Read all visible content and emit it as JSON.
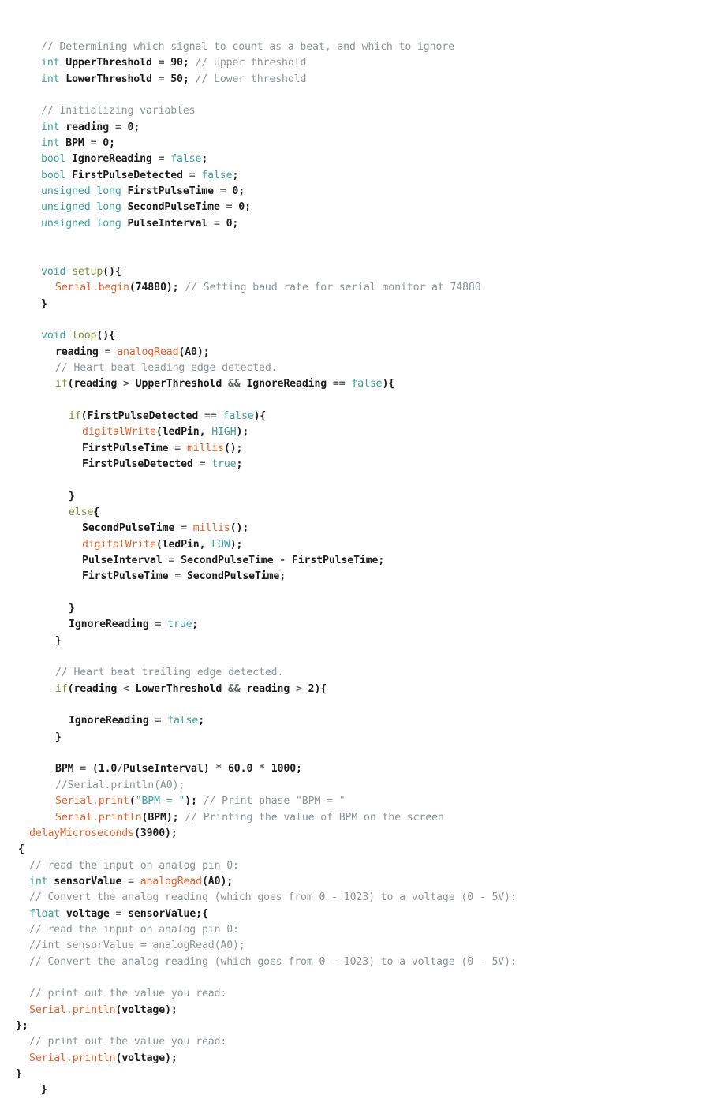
{
  "document": {
    "type": "source-code-listing",
    "language": "Arduino C++",
    "background_color": "#ffffff",
    "colors": {
      "keyword": "#3c9f9f",
      "constant": "#3c9f9f",
      "string": "#3c9f9f",
      "function": "#e8612a",
      "function_name": "#7f8f34",
      "control": "#7f8f34",
      "comment": "#8e9498",
      "plain": "#1c1c1c",
      "operator": "#5a5f63"
    }
  },
  "lines": [
    {
      "indent": 52,
      "tokens": [
        {
          "c": "comment",
          "t": "// Determining which signal to count as a beat, and which to ignore"
        }
      ]
    },
    {
      "indent": 52,
      "tokens": [
        {
          "c": "kw",
          "t": "int"
        },
        {
          "c": "plain",
          "t": " UpperThreshold "
        },
        {
          "c": "op",
          "t": "="
        },
        {
          "c": "num",
          "t": " 90"
        },
        {
          "c": "punc",
          "t": ";"
        },
        {
          "c": "comment",
          "t": " // Upper threshold"
        }
      ]
    },
    {
      "indent": 52,
      "tokens": [
        {
          "c": "kw",
          "t": "int"
        },
        {
          "c": "plain",
          "t": " LowerThreshold "
        },
        {
          "c": "op",
          "t": "="
        },
        {
          "c": "num",
          "t": " 50"
        },
        {
          "c": "punc",
          "t": ";"
        },
        {
          "c": "comment",
          "t": " // Lower threshold"
        }
      ]
    },
    {
      "indent": 52,
      "tokens": []
    },
    {
      "indent": 52,
      "tokens": [
        {
          "c": "comment",
          "t": "// Initializing variables"
        }
      ]
    },
    {
      "indent": 52,
      "tokens": [
        {
          "c": "kw",
          "t": "int"
        },
        {
          "c": "plain",
          "t": " reading "
        },
        {
          "c": "op",
          "t": "="
        },
        {
          "c": "num",
          "t": " 0"
        },
        {
          "c": "punc",
          "t": ";"
        }
      ]
    },
    {
      "indent": 52,
      "tokens": [
        {
          "c": "kw",
          "t": "int"
        },
        {
          "c": "plain",
          "t": " BPM "
        },
        {
          "c": "op",
          "t": "="
        },
        {
          "c": "num",
          "t": " 0"
        },
        {
          "c": "punc",
          "t": ";"
        }
      ]
    },
    {
      "indent": 52,
      "tokens": [
        {
          "c": "kw",
          "t": "bool"
        },
        {
          "c": "plain",
          "t": " IgnoreReading "
        },
        {
          "c": "op",
          "t": "="
        },
        {
          "c": "const",
          "t": " false"
        },
        {
          "c": "punc",
          "t": ";"
        }
      ]
    },
    {
      "indent": 52,
      "tokens": [
        {
          "c": "kw",
          "t": "bool"
        },
        {
          "c": "plain",
          "t": " FirstPulseDetected "
        },
        {
          "c": "op",
          "t": "="
        },
        {
          "c": "const",
          "t": " false"
        },
        {
          "c": "punc",
          "t": ";"
        }
      ]
    },
    {
      "indent": 52,
      "tokens": [
        {
          "c": "kw",
          "t": "unsigned long"
        },
        {
          "c": "plain",
          "t": " FirstPulseTime "
        },
        {
          "c": "op",
          "t": "="
        },
        {
          "c": "num",
          "t": " 0"
        },
        {
          "c": "punc",
          "t": ";"
        }
      ]
    },
    {
      "indent": 52,
      "tokens": [
        {
          "c": "kw",
          "t": "unsigned long"
        },
        {
          "c": "plain",
          "t": " SecondPulseTime "
        },
        {
          "c": "op",
          "t": "="
        },
        {
          "c": "num",
          "t": " 0"
        },
        {
          "c": "punc",
          "t": ";"
        }
      ]
    },
    {
      "indent": 52,
      "tokens": [
        {
          "c": "kw",
          "t": "unsigned long"
        },
        {
          "c": "plain",
          "t": " PulseInterval "
        },
        {
          "c": "op",
          "t": "="
        },
        {
          "c": "num",
          "t": " 0"
        },
        {
          "c": "punc",
          "t": ";"
        }
      ]
    },
    {
      "indent": 52,
      "tokens": []
    },
    {
      "indent": 52,
      "tokens": []
    },
    {
      "indent": 52,
      "tokens": [
        {
          "c": "kw",
          "t": "void"
        },
        {
          "c": "fname",
          "t": " setup"
        },
        {
          "c": "punc",
          "t": "(){"
        }
      ]
    },
    {
      "indent": 70,
      "tokens": [
        {
          "c": "func",
          "t": "Serial.begin"
        },
        {
          "c": "punc",
          "t": "("
        },
        {
          "c": "num",
          "t": "74880"
        },
        {
          "c": "punc",
          "t": ");"
        },
        {
          "c": "comment",
          "t": " // Setting baud rate for serial monitor at 74880"
        }
      ]
    },
    {
      "indent": 52,
      "tokens": [
        {
          "c": "punc",
          "t": "}"
        }
      ]
    },
    {
      "indent": 52,
      "tokens": []
    },
    {
      "indent": 52,
      "tokens": [
        {
          "c": "kw",
          "t": "void"
        },
        {
          "c": "fname",
          "t": " loop"
        },
        {
          "c": "punc",
          "t": "(){"
        }
      ]
    },
    {
      "indent": 70,
      "tokens": [
        {
          "c": "plain",
          "t": "reading "
        },
        {
          "c": "op",
          "t": "="
        },
        {
          "c": "func",
          "t": " analogRead"
        },
        {
          "c": "punc",
          "t": "("
        },
        {
          "c": "plain",
          "t": "A0"
        },
        {
          "c": "punc",
          "t": ");"
        }
      ]
    },
    {
      "indent": 70,
      "tokens": [
        {
          "c": "comment",
          "t": "// Heart beat leading edge detected."
        }
      ]
    },
    {
      "indent": 70,
      "tokens": [
        {
          "c": "ctrl",
          "t": "if"
        },
        {
          "c": "punc",
          "t": "("
        },
        {
          "c": "plain",
          "t": "reading "
        },
        {
          "c": "op",
          "t": ">"
        },
        {
          "c": "plain",
          "t": " UpperThreshold "
        },
        {
          "c": "op",
          "t": "&&"
        },
        {
          "c": "plain",
          "t": " IgnoreReading "
        },
        {
          "c": "op",
          "t": "=="
        },
        {
          "c": "const",
          "t": " false"
        },
        {
          "c": "punc",
          "t": "){"
        }
      ]
    },
    {
      "indent": 70,
      "tokens": []
    },
    {
      "indent": 87,
      "tokens": [
        {
          "c": "ctrl",
          "t": "if"
        },
        {
          "c": "punc",
          "t": "("
        },
        {
          "c": "plain",
          "t": "FirstPulseDetected "
        },
        {
          "c": "op",
          "t": "=="
        },
        {
          "c": "const",
          "t": " false"
        },
        {
          "c": "punc",
          "t": "){"
        }
      ]
    },
    {
      "indent": 104,
      "tokens": [
        {
          "c": "func",
          "t": "digitalWrite"
        },
        {
          "c": "punc",
          "t": "("
        },
        {
          "c": "plain",
          "t": "ledPin, "
        },
        {
          "c": "const",
          "t": "HIGH"
        },
        {
          "c": "punc",
          "t": ");"
        }
      ]
    },
    {
      "indent": 104,
      "tokens": [
        {
          "c": "plain",
          "t": "FirstPulseTime "
        },
        {
          "c": "op",
          "t": "="
        },
        {
          "c": "func",
          "t": " millis"
        },
        {
          "c": "punc",
          "t": "();"
        }
      ]
    },
    {
      "indent": 104,
      "tokens": [
        {
          "c": "plain",
          "t": "FirstPulseDetected "
        },
        {
          "c": "op",
          "t": "="
        },
        {
          "c": "const",
          "t": " true"
        },
        {
          "c": "punc",
          "t": ";"
        }
      ]
    },
    {
      "indent": 104,
      "tokens": []
    },
    {
      "indent": 87,
      "tokens": [
        {
          "c": "punc",
          "t": "}"
        }
      ]
    },
    {
      "indent": 87,
      "tokens": [
        {
          "c": "ctrl",
          "t": "else"
        },
        {
          "c": "punc",
          "t": "{"
        }
      ]
    },
    {
      "indent": 104,
      "tokens": [
        {
          "c": "plain",
          "t": "SecondPulseTime "
        },
        {
          "c": "op",
          "t": "="
        },
        {
          "c": "func",
          "t": " millis"
        },
        {
          "c": "punc",
          "t": "();"
        }
      ]
    },
    {
      "indent": 104,
      "tokens": [
        {
          "c": "func",
          "t": "digitalWrite"
        },
        {
          "c": "punc",
          "t": "("
        },
        {
          "c": "plain",
          "t": "ledPin, "
        },
        {
          "c": "const",
          "t": "LOW"
        },
        {
          "c": "punc",
          "t": ");"
        }
      ]
    },
    {
      "indent": 104,
      "tokens": [
        {
          "c": "plain",
          "t": "PulseInterval "
        },
        {
          "c": "op",
          "t": "="
        },
        {
          "c": "plain",
          "t": " SecondPulseTime "
        },
        {
          "c": "op",
          "t": "-"
        },
        {
          "c": "plain",
          "t": " FirstPulseTime"
        },
        {
          "c": "punc",
          "t": ";"
        }
      ]
    },
    {
      "indent": 104,
      "tokens": [
        {
          "c": "plain",
          "t": "FirstPulseTime "
        },
        {
          "c": "op",
          "t": "="
        },
        {
          "c": "plain",
          "t": " SecondPulseTime"
        },
        {
          "c": "punc",
          "t": ";"
        }
      ]
    },
    {
      "indent": 104,
      "tokens": []
    },
    {
      "indent": 87,
      "tokens": [
        {
          "c": "punc",
          "t": "}"
        }
      ]
    },
    {
      "indent": 87,
      "tokens": [
        {
          "c": "plain",
          "t": "IgnoreReading "
        },
        {
          "c": "op",
          "t": "="
        },
        {
          "c": "const",
          "t": " true"
        },
        {
          "c": "punc",
          "t": ";"
        }
      ]
    },
    {
      "indent": 70,
      "tokens": [
        {
          "c": "punc",
          "t": "}"
        }
      ]
    },
    {
      "indent": 70,
      "tokens": []
    },
    {
      "indent": 70,
      "tokens": [
        {
          "c": "comment",
          "t": "// Heart beat trailing edge detected."
        }
      ]
    },
    {
      "indent": 70,
      "tokens": [
        {
          "c": "ctrl",
          "t": "if"
        },
        {
          "c": "punc",
          "t": "("
        },
        {
          "c": "plain",
          "t": "reading "
        },
        {
          "c": "op",
          "t": "<"
        },
        {
          "c": "plain",
          "t": " LowerThreshold "
        },
        {
          "c": "op",
          "t": "&&"
        },
        {
          "c": "plain",
          "t": " reading "
        },
        {
          "c": "op",
          "t": ">"
        },
        {
          "c": "num",
          "t": " 2"
        },
        {
          "c": "punc",
          "t": "){"
        }
      ]
    },
    {
      "indent": 70,
      "tokens": []
    },
    {
      "indent": 87,
      "tokens": [
        {
          "c": "plain",
          "t": "IgnoreReading "
        },
        {
          "c": "op",
          "t": "="
        },
        {
          "c": "const",
          "t": " false"
        },
        {
          "c": "punc",
          "t": ";"
        }
      ]
    },
    {
      "indent": 70,
      "tokens": [
        {
          "c": "punc",
          "t": "}"
        }
      ]
    },
    {
      "indent": 70,
      "tokens": []
    },
    {
      "indent": 70,
      "tokens": [
        {
          "c": "plain",
          "t": "BPM "
        },
        {
          "c": "op",
          "t": "="
        },
        {
          "c": "punc",
          "t": " ("
        },
        {
          "c": "num",
          "t": "1.0"
        },
        {
          "c": "op",
          "t": "/"
        },
        {
          "c": "plain",
          "t": "PulseInterval"
        },
        {
          "c": "punc",
          "t": ") "
        },
        {
          "c": "op",
          "t": "*"
        },
        {
          "c": "num",
          "t": " 60.0 "
        },
        {
          "c": "op",
          "t": "*"
        },
        {
          "c": "num",
          "t": " 1000"
        },
        {
          "c": "punc",
          "t": ";"
        }
      ]
    },
    {
      "indent": 70,
      "tokens": [
        {
          "c": "comment",
          "t": "//Serial.println(A0);"
        }
      ]
    },
    {
      "indent": 70,
      "tokens": [
        {
          "c": "func",
          "t": "Serial.print"
        },
        {
          "c": "punc",
          "t": "("
        },
        {
          "c": "str",
          "t": "\"BPM = \""
        },
        {
          "c": "punc",
          "t": ");"
        },
        {
          "c": "comment",
          "t": " // Print phase \"BPM = \""
        }
      ]
    },
    {
      "indent": 70,
      "tokens": [
        {
          "c": "func",
          "t": "Serial.println"
        },
        {
          "c": "punc",
          "t": "("
        },
        {
          "c": "plain",
          "t": "BPM"
        },
        {
          "c": "punc",
          "t": ");"
        },
        {
          "c": "comment",
          "t": " // Printing the value of BPM on the screen"
        }
      ]
    },
    {
      "indent": 37,
      "tokens": [
        {
          "c": "func",
          "t": "delayMicroseconds"
        },
        {
          "c": "punc",
          "t": "("
        },
        {
          "c": "num",
          "t": "3900"
        },
        {
          "c": "punc",
          "t": ");"
        }
      ]
    },
    {
      "indent": 23,
      "tokens": [
        {
          "c": "punc",
          "t": "{"
        }
      ]
    },
    {
      "indent": 37,
      "tokens": [
        {
          "c": "comment",
          "t": "// read the input on analog pin 0:"
        }
      ]
    },
    {
      "indent": 37,
      "tokens": [
        {
          "c": "kw",
          "t": "int"
        },
        {
          "c": "plain",
          "t": " sensorValue "
        },
        {
          "c": "op",
          "t": "="
        },
        {
          "c": "func",
          "t": " analogRead"
        },
        {
          "c": "punc",
          "t": "("
        },
        {
          "c": "plain",
          "t": "A0"
        },
        {
          "c": "punc",
          "t": ");"
        }
      ]
    },
    {
      "indent": 37,
      "tokens": [
        {
          "c": "comment",
          "t": "// Convert the analog reading (which goes from 0 - 1023) to a voltage (0 - 5V):"
        }
      ]
    },
    {
      "indent": 37,
      "tokens": [
        {
          "c": "kw",
          "t": "float"
        },
        {
          "c": "plain",
          "t": " voltage "
        },
        {
          "c": "op",
          "t": "="
        },
        {
          "c": "plain",
          "t": " sensorValue"
        },
        {
          "c": "punc",
          "t": ";{"
        }
      ]
    },
    {
      "indent": 37,
      "tokens": [
        {
          "c": "comment",
          "t": "// read the input on analog pin 0:"
        }
      ]
    },
    {
      "indent": 37,
      "tokens": [
        {
          "c": "comment",
          "t": "//int sensorValue = analogRead(A0);"
        }
      ]
    },
    {
      "indent": 37,
      "tokens": [
        {
          "c": "comment",
          "t": "// Convert the analog reading (which goes from 0 - 1023) to a voltage (0 - 5V):"
        }
      ]
    },
    {
      "indent": 37,
      "tokens": []
    },
    {
      "indent": 37,
      "tokens": [
        {
          "c": "comment",
          "t": "// print out the value you read:"
        }
      ]
    },
    {
      "indent": 37,
      "tokens": [
        {
          "c": "func",
          "t": "Serial.println"
        },
        {
          "c": "punc",
          "t": "("
        },
        {
          "c": "plain",
          "t": "voltage"
        },
        {
          "c": "punc",
          "t": ");"
        }
      ]
    },
    {
      "indent": 20,
      "tokens": [
        {
          "c": "punc",
          "t": "};"
        }
      ]
    },
    {
      "indent": 37,
      "tokens": [
        {
          "c": "comment",
          "t": "// print out the value you read:"
        }
      ]
    },
    {
      "indent": 37,
      "tokens": [
        {
          "c": "func",
          "t": "Serial.println"
        },
        {
          "c": "punc",
          "t": "("
        },
        {
          "c": "plain",
          "t": "voltage"
        },
        {
          "c": "punc",
          "t": ");"
        }
      ]
    },
    {
      "indent": 20,
      "tokens": [
        {
          "c": "punc",
          "t": "}"
        }
      ]
    },
    {
      "indent": 52,
      "tokens": [
        {
          "c": "punc",
          "t": "}"
        }
      ]
    }
  ]
}
